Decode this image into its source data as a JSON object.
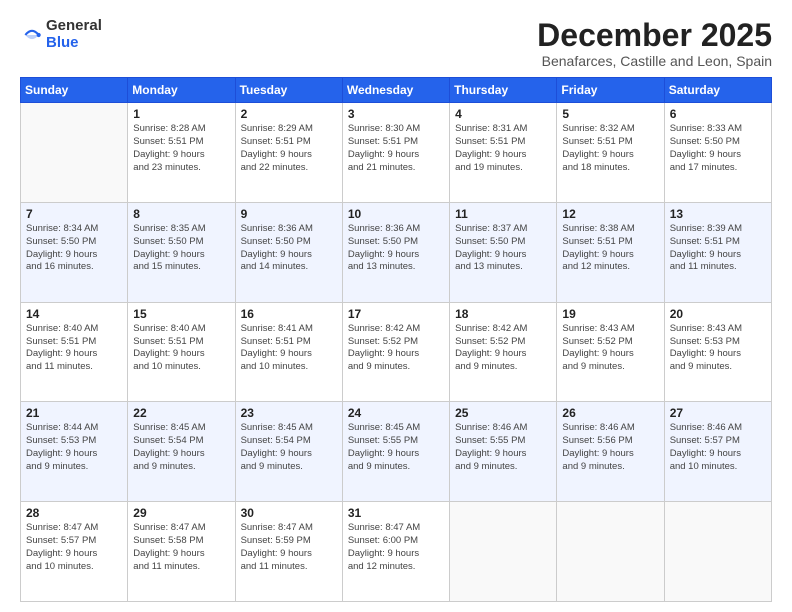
{
  "header": {
    "logo": {
      "general": "General",
      "blue": "Blue"
    },
    "title": "December 2025",
    "location": "Benafarces, Castille and Leon, Spain"
  },
  "weekdays": [
    "Sunday",
    "Monday",
    "Tuesday",
    "Wednesday",
    "Thursday",
    "Friday",
    "Saturday"
  ],
  "weeks": [
    [
      {
        "day": null,
        "info": null
      },
      {
        "day": "1",
        "info": "Sunrise: 8:28 AM\nSunset: 5:51 PM\nDaylight: 9 hours\nand 23 minutes."
      },
      {
        "day": "2",
        "info": "Sunrise: 8:29 AM\nSunset: 5:51 PM\nDaylight: 9 hours\nand 22 minutes."
      },
      {
        "day": "3",
        "info": "Sunrise: 8:30 AM\nSunset: 5:51 PM\nDaylight: 9 hours\nand 21 minutes."
      },
      {
        "day": "4",
        "info": "Sunrise: 8:31 AM\nSunset: 5:51 PM\nDaylight: 9 hours\nand 19 minutes."
      },
      {
        "day": "5",
        "info": "Sunrise: 8:32 AM\nSunset: 5:51 PM\nDaylight: 9 hours\nand 18 minutes."
      },
      {
        "day": "6",
        "info": "Sunrise: 8:33 AM\nSunset: 5:50 PM\nDaylight: 9 hours\nand 17 minutes."
      }
    ],
    [
      {
        "day": "7",
        "info": "Sunrise: 8:34 AM\nSunset: 5:50 PM\nDaylight: 9 hours\nand 16 minutes."
      },
      {
        "day": "8",
        "info": "Sunrise: 8:35 AM\nSunset: 5:50 PM\nDaylight: 9 hours\nand 15 minutes."
      },
      {
        "day": "9",
        "info": "Sunrise: 8:36 AM\nSunset: 5:50 PM\nDaylight: 9 hours\nand 14 minutes."
      },
      {
        "day": "10",
        "info": "Sunrise: 8:36 AM\nSunset: 5:50 PM\nDaylight: 9 hours\nand 13 minutes."
      },
      {
        "day": "11",
        "info": "Sunrise: 8:37 AM\nSunset: 5:50 PM\nDaylight: 9 hours\nand 13 minutes."
      },
      {
        "day": "12",
        "info": "Sunrise: 8:38 AM\nSunset: 5:51 PM\nDaylight: 9 hours\nand 12 minutes."
      },
      {
        "day": "13",
        "info": "Sunrise: 8:39 AM\nSunset: 5:51 PM\nDaylight: 9 hours\nand 11 minutes."
      }
    ],
    [
      {
        "day": "14",
        "info": "Sunrise: 8:40 AM\nSunset: 5:51 PM\nDaylight: 9 hours\nand 11 minutes."
      },
      {
        "day": "15",
        "info": "Sunrise: 8:40 AM\nSunset: 5:51 PM\nDaylight: 9 hours\nand 10 minutes."
      },
      {
        "day": "16",
        "info": "Sunrise: 8:41 AM\nSunset: 5:51 PM\nDaylight: 9 hours\nand 10 minutes."
      },
      {
        "day": "17",
        "info": "Sunrise: 8:42 AM\nSunset: 5:52 PM\nDaylight: 9 hours\nand 9 minutes."
      },
      {
        "day": "18",
        "info": "Sunrise: 8:42 AM\nSunset: 5:52 PM\nDaylight: 9 hours\nand 9 minutes."
      },
      {
        "day": "19",
        "info": "Sunrise: 8:43 AM\nSunset: 5:52 PM\nDaylight: 9 hours\nand 9 minutes."
      },
      {
        "day": "20",
        "info": "Sunrise: 8:43 AM\nSunset: 5:53 PM\nDaylight: 9 hours\nand 9 minutes."
      }
    ],
    [
      {
        "day": "21",
        "info": "Sunrise: 8:44 AM\nSunset: 5:53 PM\nDaylight: 9 hours\nand 9 minutes."
      },
      {
        "day": "22",
        "info": "Sunrise: 8:45 AM\nSunset: 5:54 PM\nDaylight: 9 hours\nand 9 minutes."
      },
      {
        "day": "23",
        "info": "Sunrise: 8:45 AM\nSunset: 5:54 PM\nDaylight: 9 hours\nand 9 minutes."
      },
      {
        "day": "24",
        "info": "Sunrise: 8:45 AM\nSunset: 5:55 PM\nDaylight: 9 hours\nand 9 minutes."
      },
      {
        "day": "25",
        "info": "Sunrise: 8:46 AM\nSunset: 5:55 PM\nDaylight: 9 hours\nand 9 minutes."
      },
      {
        "day": "26",
        "info": "Sunrise: 8:46 AM\nSunset: 5:56 PM\nDaylight: 9 hours\nand 9 minutes."
      },
      {
        "day": "27",
        "info": "Sunrise: 8:46 AM\nSunset: 5:57 PM\nDaylight: 9 hours\nand 10 minutes."
      }
    ],
    [
      {
        "day": "28",
        "info": "Sunrise: 8:47 AM\nSunset: 5:57 PM\nDaylight: 9 hours\nand 10 minutes."
      },
      {
        "day": "29",
        "info": "Sunrise: 8:47 AM\nSunset: 5:58 PM\nDaylight: 9 hours\nand 11 minutes."
      },
      {
        "day": "30",
        "info": "Sunrise: 8:47 AM\nSunset: 5:59 PM\nDaylight: 9 hours\nand 11 minutes."
      },
      {
        "day": "31",
        "info": "Sunrise: 8:47 AM\nSunset: 6:00 PM\nDaylight: 9 hours\nand 12 minutes."
      },
      {
        "day": null,
        "info": null
      },
      {
        "day": null,
        "info": null
      },
      {
        "day": null,
        "info": null
      }
    ]
  ]
}
